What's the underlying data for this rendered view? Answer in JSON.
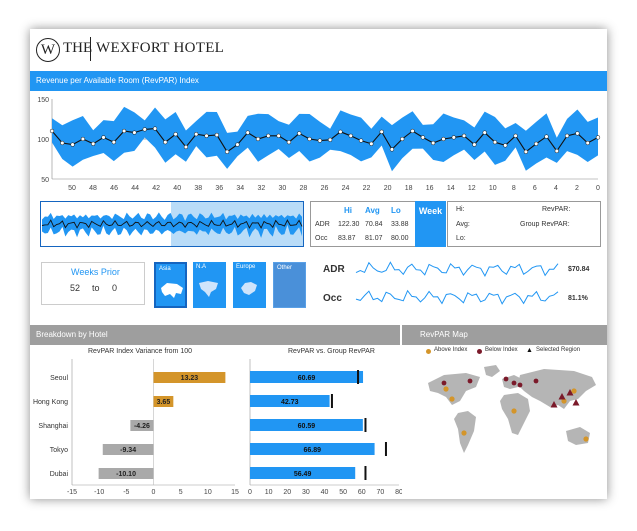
{
  "brand": {
    "logo_letter": "W",
    "the": "THE",
    "name": "WEXFORT HOTEL"
  },
  "revpar_section": {
    "title": "Revenue per Available Room (RevPAR) Index",
    "y_ticks": [
      "150",
      "100",
      "50"
    ],
    "x_ticks": [
      "50",
      "48",
      "46",
      "44",
      "42",
      "40",
      "38",
      "36",
      "34",
      "32",
      "30",
      "28",
      "26",
      "24",
      "22",
      "20",
      "18",
      "16",
      "14",
      "12",
      "10",
      "8",
      "6",
      "4",
      "2",
      "0"
    ],
    "series_values": [
      110,
      95,
      93,
      100,
      94,
      102,
      96,
      110,
      108,
      112,
      113,
      96,
      106,
      90,
      106,
      104,
      105,
      84,
      93,
      108,
      100,
      104,
      104,
      96,
      107,
      100,
      98,
      99,
      109,
      104,
      98,
      94,
      109,
      87,
      100,
      110,
      102,
      95,
      100,
      102,
      104,
      93,
      108,
      96,
      92,
      104,
      84,
      94,
      103,
      85,
      104,
      107,
      95,
      102
    ]
  },
  "stats": {
    "headers": [
      "Hi",
      "Avg",
      "Lo"
    ],
    "rows": [
      {
        "label": "ADR",
        "hi": "122.30",
        "avg": "70.84",
        "lo": "33.88"
      },
      {
        "label": "Occ",
        "hi": "83.87",
        "avg": "81.07",
        "lo": "80.00"
      }
    ]
  },
  "week": {
    "title": "Week",
    "hi_label": "Hi:",
    "avg_label": "Avg:",
    "lo_label": "Lo:",
    "revpar_label": "RevPAR:",
    "group_revpar_label": "Group RevPAR:"
  },
  "weeks_prior": {
    "title": "Weeks Prior",
    "from": "52",
    "to_label": "to",
    "to": "0"
  },
  "regions": [
    {
      "label": "Asia",
      "selected": true
    },
    {
      "label": "N.A",
      "selected": false
    },
    {
      "label": "Europe",
      "selected": false
    },
    {
      "label": "Other",
      "selected": false
    }
  ],
  "sparklines": {
    "adr": {
      "label": "ADR",
      "value": "$70.84"
    },
    "occ": {
      "label": "Occ",
      "value": "81.1%"
    }
  },
  "breakdown": {
    "title": "Breakdown by Hotel",
    "variance_title": "RevPAR Index Variance from 100",
    "group_title": "RevPAR vs. Group RevPAR"
  },
  "map": {
    "title": "RevPAR Map",
    "legend": [
      "Above Index",
      "Below Index",
      "Selected Region"
    ]
  },
  "colors": {
    "accent": "#2196F3",
    "above": "#D4952A",
    "below": "#7b1a2a",
    "neutral": "#9e9e9e"
  },
  "chart_data": [
    {
      "type": "bar",
      "title": "RevPAR Index Variance from 100",
      "categories": [
        "Seoul",
        "Hong Kong",
        "Shanghai",
        "Tokyo",
        "Dubai"
      ],
      "values": [
        13.23,
        3.65,
        -4.26,
        -9.34,
        -10.1
      ],
      "value_labels": [
        "13.23",
        "3.65",
        "-4.26",
        "-9.34",
        "-10.10"
      ],
      "x_ticks": [
        "-15",
        "-10",
        "-5",
        "0",
        "5",
        "10",
        "15"
      ],
      "xlim": [
        -15,
        15
      ]
    },
    {
      "type": "bar",
      "title": "RevPAR vs. Group RevPAR",
      "categories": [
        "Seoul",
        "Hong Kong",
        "Shanghai",
        "Tokyo",
        "Dubai"
      ],
      "values": [
        60.69,
        42.73,
        60.59,
        66.89,
        56.49
      ],
      "value_labels": [
        "60.69",
        "42.73",
        "60.59",
        "66.89",
        "56.49"
      ],
      "group_values": [
        58,
        44,
        62,
        73,
        62
      ],
      "x_ticks": [
        "0",
        "10",
        "20",
        "30",
        "40",
        "50",
        "60",
        "70",
        "80"
      ],
      "xlim": [
        0,
        80
      ]
    }
  ]
}
